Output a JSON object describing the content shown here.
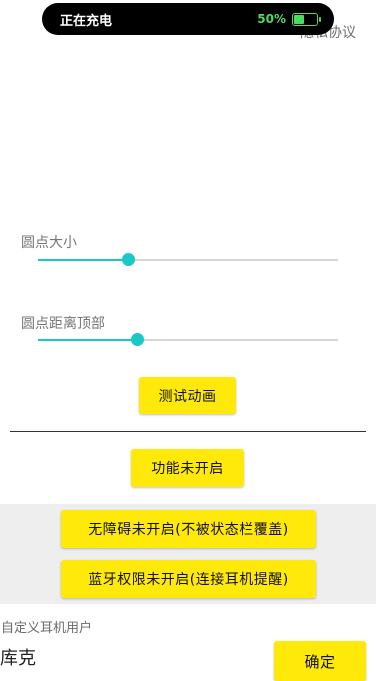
{
  "status_bar": {
    "charging_text": "正在充电",
    "battery_percent_text": "50%",
    "battery_level": 0.5,
    "accent_color": "#4cd964"
  },
  "header": {
    "privacy_link": "隐私协议"
  },
  "dot_size": {
    "label": "圆点大小",
    "value_fraction": 0.3
  },
  "dot_distance": {
    "label": "圆点距离顶部",
    "value_fraction": 0.33
  },
  "buttons": {
    "test_animation": "测试动画",
    "feature_status": "功能未开启",
    "accessibility": "无障碍未开启(不被状态栏覆盖)",
    "bluetooth": "蓝牙权限未开启(连接耳机提醒)",
    "confirm": "确定"
  },
  "custom_user": {
    "label": "自定义耳机用户",
    "value": "库克"
  },
  "colors": {
    "button_yellow": "#ffe90a",
    "slider_teal": "#1bc8c8"
  }
}
